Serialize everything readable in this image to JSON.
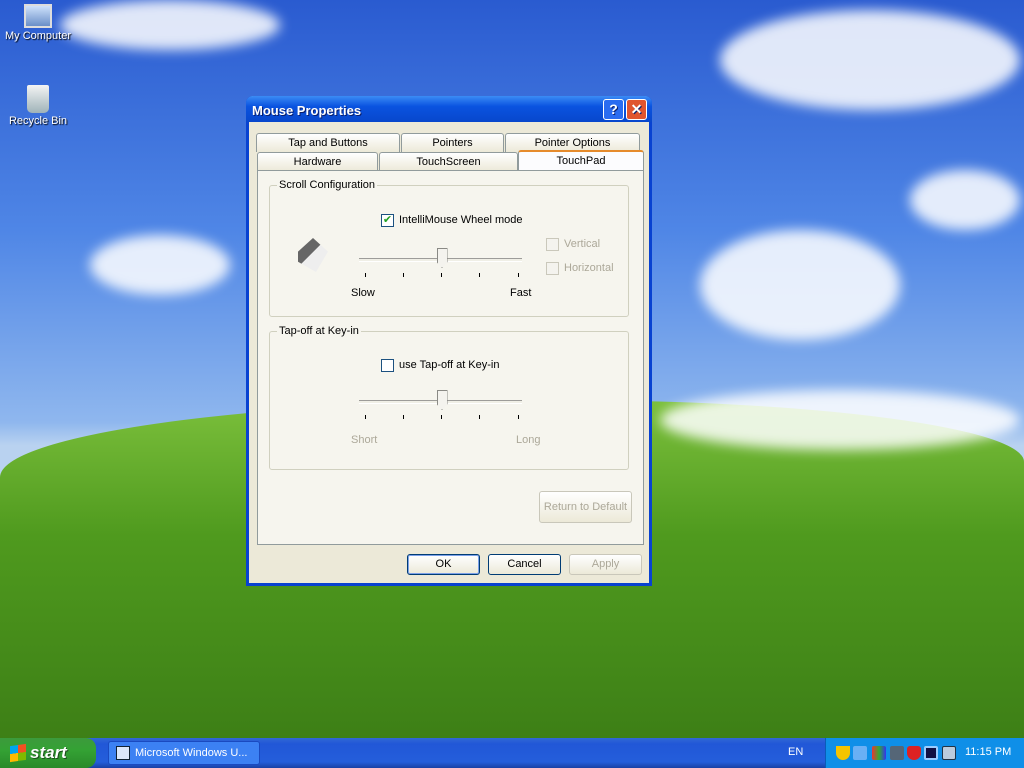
{
  "desktop": {
    "icons": [
      {
        "label": "My Computer",
        "icon": "my-computer-icon"
      },
      {
        "label": "Recycle Bin",
        "icon": "recycle-bin-icon"
      }
    ]
  },
  "dialog": {
    "title": "Mouse Properties",
    "tabs_row1": [
      "Tap and Buttons",
      "Pointers",
      "Pointer Options"
    ],
    "tabs_row2": [
      "Hardware",
      "TouchScreen",
      "TouchPad"
    ],
    "active_tab": "TouchPad",
    "scroll": {
      "group_label": "Scroll Configuration",
      "wheel_label": "IntelliMouse Wheel mode",
      "wheel_checked": true,
      "vertical_label": "Vertical",
      "horizontal_label": "Horizontal",
      "slow_label": "Slow",
      "fast_label": "Fast",
      "speed_value": 0.5
    },
    "tapoff": {
      "group_label": "Tap-off at Key-in",
      "checkbox_label": "use Tap-off at Key-in",
      "checked": false,
      "short_label": "Short",
      "long_label": "Long",
      "value": 0.5
    },
    "return_default": "Return to Default",
    "ok": "OK",
    "cancel": "Cancel",
    "apply": "Apply"
  },
  "taskbar": {
    "start": "start",
    "task": "Microsoft Windows U...",
    "language": "EN",
    "clock": "11:15 PM"
  }
}
